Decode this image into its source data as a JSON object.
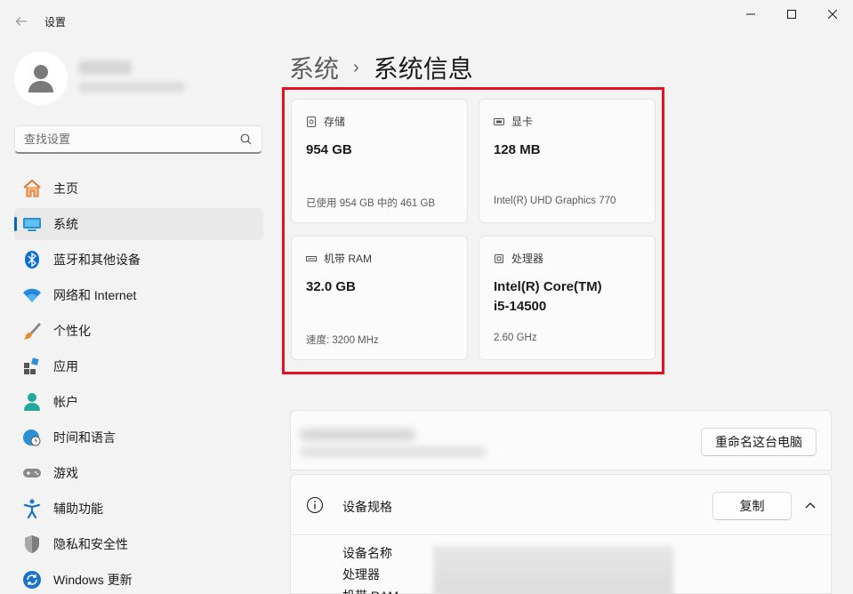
{
  "window": {
    "title": "设置"
  },
  "search": {
    "placeholder": "查找设置"
  },
  "sidebar": {
    "items": [
      {
        "label": "主页",
        "icon": "home-icon"
      },
      {
        "label": "系统",
        "icon": "system-icon",
        "selected": true
      },
      {
        "label": "蓝牙和其他设备",
        "icon": "bluetooth-icon"
      },
      {
        "label": "网络和 Internet",
        "icon": "wifi-icon"
      },
      {
        "label": "个性化",
        "icon": "brush-icon"
      },
      {
        "label": "应用",
        "icon": "apps-icon"
      },
      {
        "label": "帐户",
        "icon": "account-icon"
      },
      {
        "label": "时间和语言",
        "icon": "clock-globe-icon"
      },
      {
        "label": "游戏",
        "icon": "gamepad-icon"
      },
      {
        "label": "辅助功能",
        "icon": "accessibility-icon"
      },
      {
        "label": "隐私和安全性",
        "icon": "shield-icon"
      },
      {
        "label": "Windows 更新",
        "icon": "update-icon"
      }
    ]
  },
  "breadcrumb": {
    "parent": "系统",
    "separator": "›",
    "current": "系统信息"
  },
  "cards": {
    "storage": {
      "label": "存储",
      "value": "954 GB",
      "sub": "已使用 954 GB 中的 461 GB"
    },
    "gpu": {
      "label": "显卡",
      "value": "128 MB",
      "sub": "Intel(R) UHD Graphics 770"
    },
    "ram": {
      "label": "机带 RAM",
      "value": "32.0 GB",
      "sub": "速度: 3200 MHz"
    },
    "cpu": {
      "label": "处理器",
      "value_line1": "Intel(R) Core(TM)",
      "value_line2": "i5-14500",
      "sub": "2.60 GHz"
    }
  },
  "rename": {
    "button": "重命名这台电脑"
  },
  "specs": {
    "title": "设备规格",
    "copy_button": "复制",
    "rows": [
      {
        "key": "设备名称"
      },
      {
        "key": "处理器"
      },
      {
        "key": "机带 RAM"
      }
    ]
  },
  "colors": {
    "accent": "#0067c0",
    "highlight": "#e81123"
  }
}
